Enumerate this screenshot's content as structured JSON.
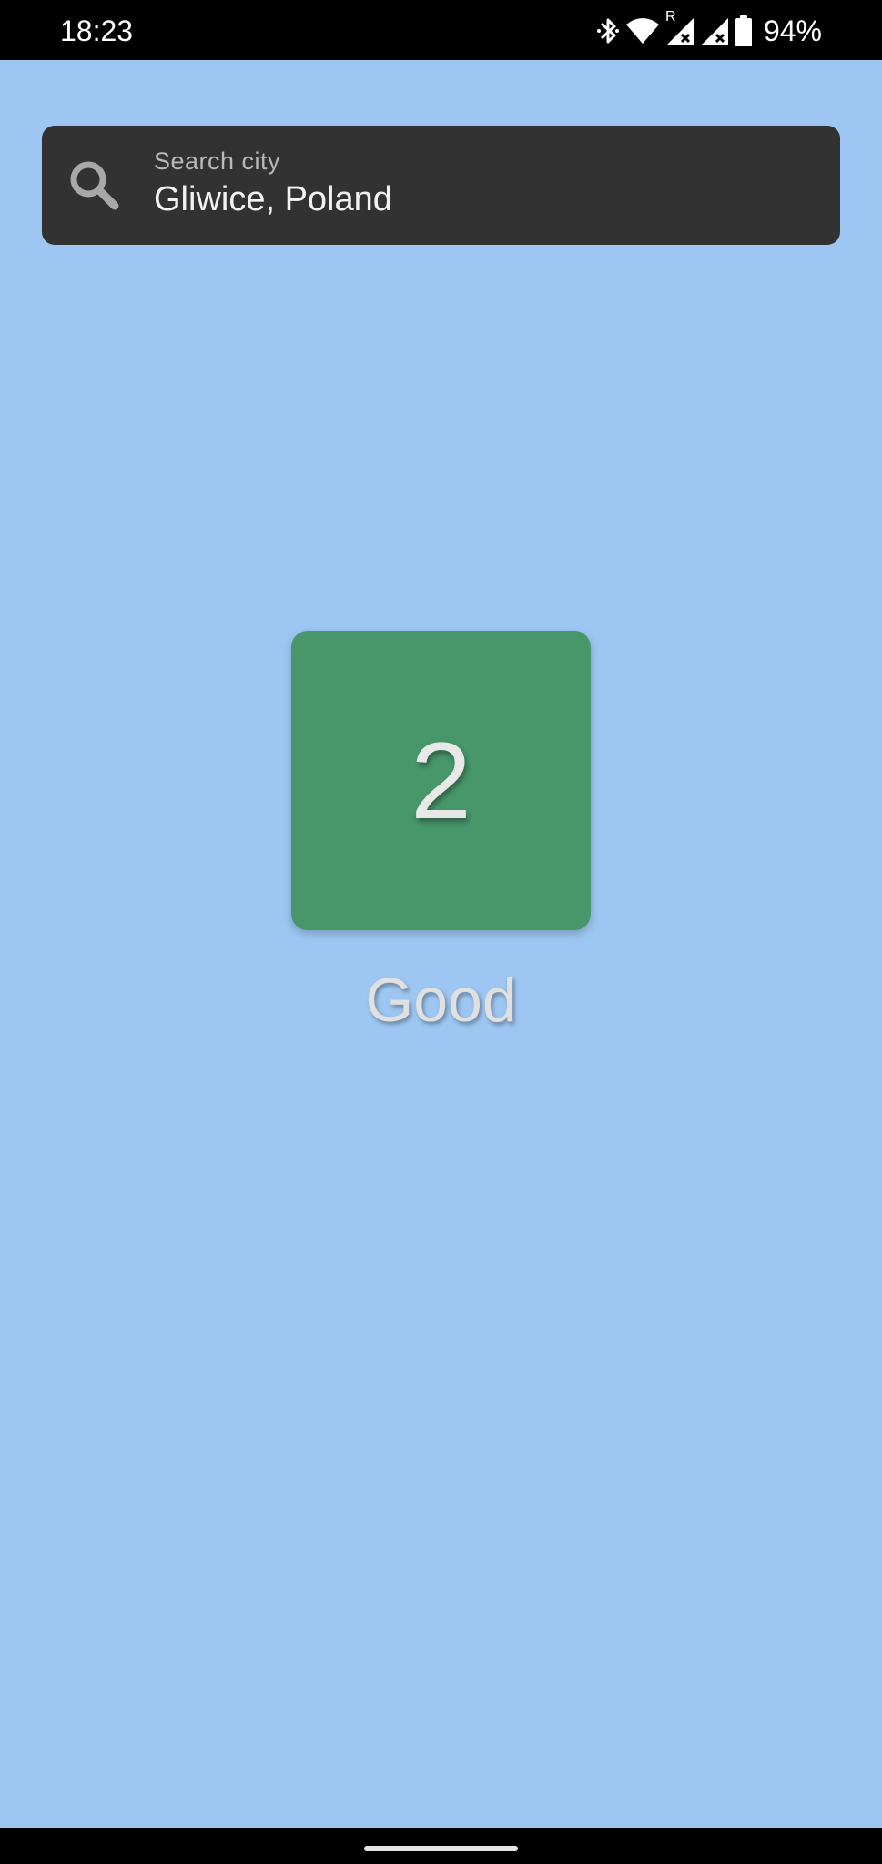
{
  "status_bar": {
    "time": "18:23",
    "battery_percent": "94%",
    "roaming_indicator": "R",
    "icons": [
      "bluetooth-icon",
      "wifi-icon",
      "cellular-signal-icon",
      "cellular-signal-icon",
      "battery-icon"
    ]
  },
  "search": {
    "label": "Search city",
    "value": "Gliwice, Poland",
    "icon": "search-icon"
  },
  "aqi": {
    "value": "2",
    "label": "Good",
    "tile_color": "#47976b"
  },
  "colors": {
    "background": "#9dc7f2",
    "search_bar": "#323232"
  }
}
